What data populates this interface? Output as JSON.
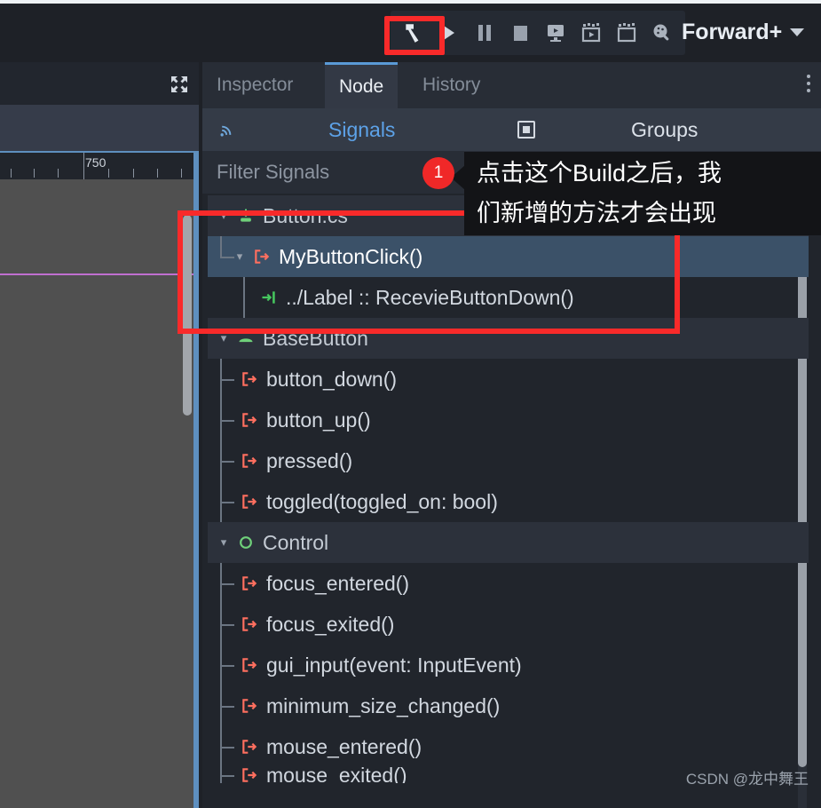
{
  "toolbar": {
    "buttons": [
      {
        "name": "build-button",
        "icon": "hammer-icon",
        "label": "Build"
      },
      {
        "name": "run-button",
        "icon": "play-icon",
        "label": "Run Project"
      },
      {
        "name": "pause-button",
        "icon": "pause-icon",
        "label": "Pause"
      },
      {
        "name": "stop-button",
        "icon": "stop-icon",
        "label": "Stop"
      },
      {
        "name": "remote-debug-button",
        "icon": "monitor-play-icon",
        "label": "Remote Debug"
      },
      {
        "name": "movie-play-button",
        "icon": "movie-play-icon",
        "label": "Play Scene"
      },
      {
        "name": "movie-stop-button",
        "icon": "movie-stop-icon",
        "label": "Play Custom Scene"
      },
      {
        "name": "render-method-button",
        "icon": "palette-icon",
        "label": "Renderer"
      }
    ],
    "renderer_label": "Forward+",
    "renderer_caret": "chevron-down-icon"
  },
  "left_panel": {
    "expand_icon": "expand-arrows-icon",
    "ruler_value": "750"
  },
  "tabs": [
    {
      "label": "Inspector",
      "active": false,
      "name": "tab-inspector"
    },
    {
      "label": "Node",
      "active": true,
      "name": "tab-node"
    },
    {
      "label": "History",
      "active": false,
      "name": "tab-history"
    }
  ],
  "tab_menu_icon": "kebab-menu-icon",
  "subtabs": {
    "signals": {
      "label": "Signals",
      "icon": "signal-wave-icon",
      "active": true
    },
    "groups": {
      "label": "Groups",
      "icon": "group-square-icon",
      "active": false
    }
  },
  "filter": {
    "placeholder": "Filter Signals",
    "value": "",
    "search_icon": "search-icon"
  },
  "tree": [
    {
      "kind": "section",
      "label": "Button.cs",
      "icon": "script-green-icon",
      "expanded": true,
      "name": "tree-section-button-cs"
    },
    {
      "kind": "signal",
      "label": "MyButtonClick()",
      "icon": "signal-icon",
      "selected": true,
      "expanded": true,
      "name": "tree-signal-mybuttonclick"
    },
    {
      "kind": "connection",
      "label": "../Label :: RecevieButtonDown()",
      "icon": "connection-arrow-icon",
      "name": "tree-connection-label-recevie-button-down"
    },
    {
      "kind": "section",
      "label": "BaseButton",
      "icon": "basebutton-green-icon",
      "expanded": true,
      "name": "tree-section-basebutton"
    },
    {
      "kind": "signal",
      "label": "button_down()",
      "icon": "signal-icon",
      "name": "tree-signal-button-down"
    },
    {
      "kind": "signal",
      "label": "button_up()",
      "icon": "signal-icon",
      "name": "tree-signal-button-up"
    },
    {
      "kind": "signal",
      "label": "pressed()",
      "icon": "signal-icon",
      "name": "tree-signal-pressed"
    },
    {
      "kind": "signal",
      "label": "toggled(toggled_on: bool)",
      "icon": "signal-icon",
      "name": "tree-signal-toggled"
    },
    {
      "kind": "section",
      "label": "Control",
      "icon": "control-circle-green-icon",
      "expanded": true,
      "name": "tree-section-control"
    },
    {
      "kind": "signal",
      "label": "focus_entered()",
      "icon": "signal-icon",
      "name": "tree-signal-focus-entered"
    },
    {
      "kind": "signal",
      "label": "focus_exited()",
      "icon": "signal-icon",
      "name": "tree-signal-focus-exited"
    },
    {
      "kind": "signal",
      "label": "gui_input(event: InputEvent)",
      "icon": "signal-icon",
      "name": "tree-signal-gui-input"
    },
    {
      "kind": "signal",
      "label": "minimum_size_changed()",
      "icon": "signal-icon",
      "name": "tree-signal-minimum-size-changed"
    },
    {
      "kind": "signal",
      "label": "mouse_entered()",
      "icon": "signal-icon",
      "name": "tree-signal-mouse-entered"
    },
    {
      "kind": "signal",
      "label": "mouse_exited()",
      "icon": "signal-icon",
      "name": "tree-signal-mouse-exited"
    }
  ],
  "annotation": {
    "badge": "1",
    "text": "点击这个Build之后，我们新增的方法才会出现",
    "line1": "点击这个Build之后，我",
    "line2": "们新增的方法才会出现",
    "highlight_color": "#f92a2a",
    "badge_color": "#f02828"
  },
  "watermark": "CSDN @龙中舞王",
  "colors": {
    "accent_blue": "#5da2e8",
    "signal_red": "#ff6f5f",
    "green": "#6fd07a",
    "selected_row": "#3b5168",
    "panel_bg": "#21252c"
  }
}
